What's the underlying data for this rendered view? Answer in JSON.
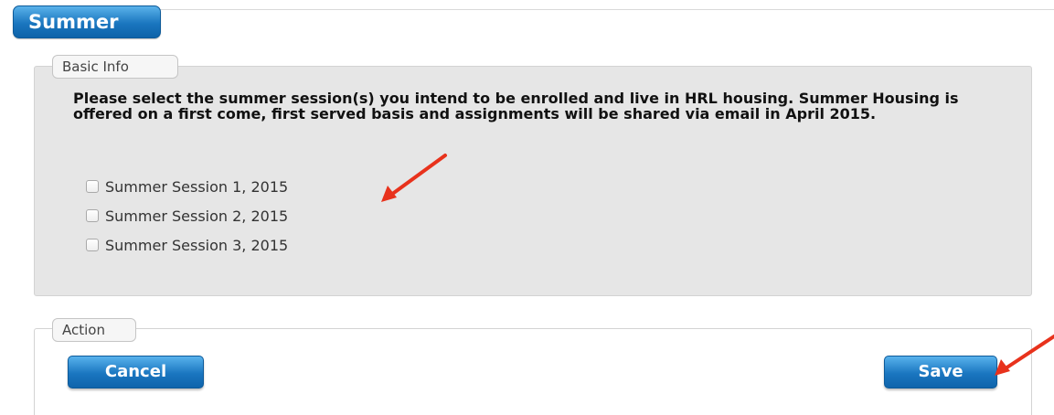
{
  "header": {
    "title": "Summer"
  },
  "basic_info": {
    "legend": "Basic Info",
    "instructions": "Please select the summer session(s) you intend to be enrolled and live in HRL housing. Summer Housing is offered on a first come, first served basis and assignments will be shared via email in April 2015.",
    "sessions": [
      {
        "label": "Summer Session 1, 2015",
        "checked": false
      },
      {
        "label": "Summer Session 2, 2015",
        "checked": false
      },
      {
        "label": "Summer Session 3, 2015",
        "checked": false
      }
    ]
  },
  "action": {
    "legend": "Action",
    "cancel_label": "Cancel",
    "save_label": "Save"
  },
  "colors": {
    "button_blue": "#1a76c0",
    "panel_gray": "#e6e6e6",
    "annotation_red": "#e8321c"
  },
  "annotations": {
    "arrows": [
      "annotation-arrow-icon",
      "annotation-arrow-icon"
    ]
  }
}
